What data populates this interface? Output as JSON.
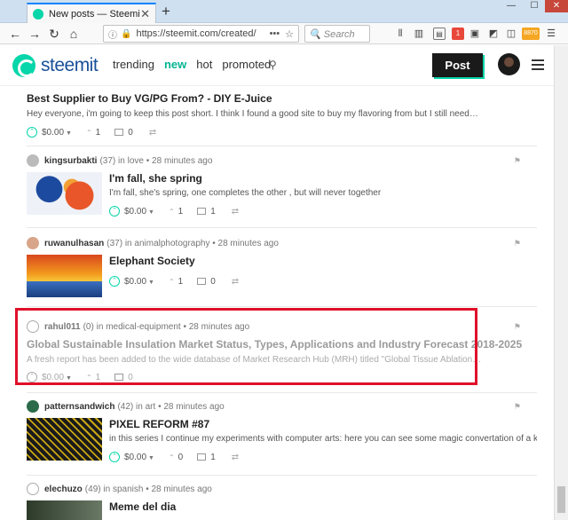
{
  "browser": {
    "tab_title": "New posts — Steemit",
    "url": "https://steemit.com/created/",
    "search_placeholder": "Search",
    "badge_count": "1",
    "ext_badge": "8870"
  },
  "header": {
    "logo": "steemit",
    "nav": [
      "trending",
      "new",
      "hot",
      "promoted"
    ],
    "active_nav": "new",
    "post_button": "Post"
  },
  "posts": [
    {
      "title": "Best Supplier to Buy VG/PG From? - DIY E-Juice",
      "excerpt": "Hey everyone, i'm going to keep this post short. I think I found a good site to buy my flavoring from but I still need…",
      "payout": "$0.00",
      "votes": "1",
      "comments": "0"
    },
    {
      "author": "kingsurbakti",
      "rep": "(37)",
      "category_prefix": "in",
      "category": "love",
      "time": "• 28 minutes ago",
      "title": "I'm fall, she spring",
      "excerpt": "I'm fall, she's spring, one completes the other , but will never together",
      "payout": "$0.00",
      "votes": "1",
      "comments": "1"
    },
    {
      "author": "ruwanulhasan",
      "rep": "(37)",
      "category_prefix": "in",
      "category": "animalphotography",
      "time": "• 28 minutes ago",
      "title": "Elephant Society",
      "excerpt": "",
      "payout": "$0.00",
      "votes": "1",
      "comments": "0"
    },
    {
      "author": "rahul011",
      "rep": "(0)",
      "category_prefix": "in",
      "category": "medical-equipment",
      "time": "• 28 minutes ago",
      "title": "Global Sustainable Insulation Market Status, Types, Applications and Industry Forecast 2018-2025",
      "excerpt": "A fresh report has been added to the wide database of Market Research Hub (MRH) titled \"Global Tissue Ablation…",
      "payout": "$0.00",
      "votes": "1",
      "comments": "0"
    },
    {
      "author": "patternsandwich",
      "rep": "(42)",
      "category_prefix": "in",
      "category": "art",
      "time": "• 28 minutes ago",
      "title": "PIXEL REFORM #87",
      "excerpt": "in this series I continue my experiments with computer arts: here you can see some magic convertation of a kitt…",
      "payout": "$0.00",
      "votes": "0",
      "comments": "1"
    },
    {
      "author": "elechuzo",
      "rep": "(49)",
      "category_prefix": "in",
      "category": "spanish",
      "time": "• 28 minutes ago",
      "title": "Meme del dia",
      "excerpt": "",
      "payout": "",
      "votes": "",
      "comments": ""
    }
  ]
}
